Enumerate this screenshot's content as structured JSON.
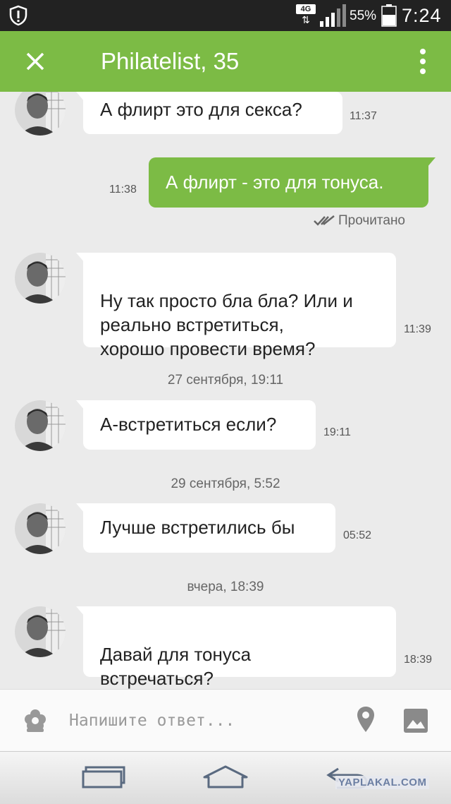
{
  "status_bar": {
    "network": "4G",
    "battery": "55%",
    "time": "7:24"
  },
  "header": {
    "title": "Philatelist, 35"
  },
  "messages": [
    {
      "text": "А флирт это для секса?",
      "time": "11:37"
    },
    {
      "text": "А флирт - это для тонуса.",
      "time": "11:38",
      "status": "Прочитано"
    },
    {
      "text": "Ну так просто бла бла? Или и\nреально встретиться,\nхорошо провести время?",
      "time": "11:39"
    },
    {
      "text": "А-встретиться если?",
      "time": "19:11"
    },
    {
      "text": "Лучше встретились бы",
      "time": "05:52"
    },
    {
      "text": "Давай для тонуса\nвстречаться?",
      "time": "18:39"
    }
  ],
  "dividers": [
    "27 сентября, 19:11",
    "29 сентября, 5:52",
    "вчера, 18:39"
  ],
  "composer": {
    "placeholder": "Напишите ответ..."
  },
  "watermark": "YAPLAKAL.COM",
  "colors": {
    "accent": "#7cbb45",
    "background": "#ebebeb",
    "status_bar": "#222222"
  }
}
